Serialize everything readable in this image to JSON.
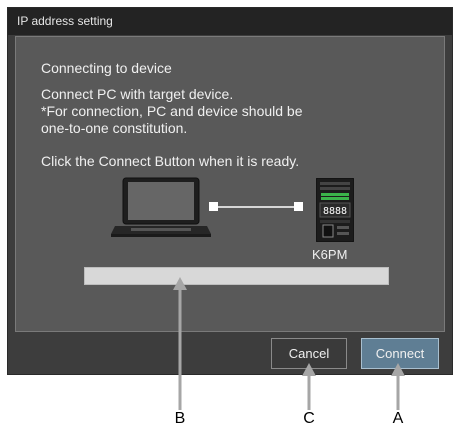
{
  "dialog": {
    "title": "IP address setting",
    "heading": "Connecting to device",
    "instructions": [
      "Connect PC with target device.",
      "*For connection, PC and device should be",
      "one-to-one constitution."
    ],
    "ready_text": "Click the Connect Button when it is ready.",
    "device_name": "K6PM",
    "device_display": "8888",
    "progress_fraction": 0,
    "buttons": {
      "cancel": "Cancel",
      "connect": "Connect"
    }
  },
  "callouts": {
    "a": "A",
    "b": "B",
    "c": "C"
  }
}
